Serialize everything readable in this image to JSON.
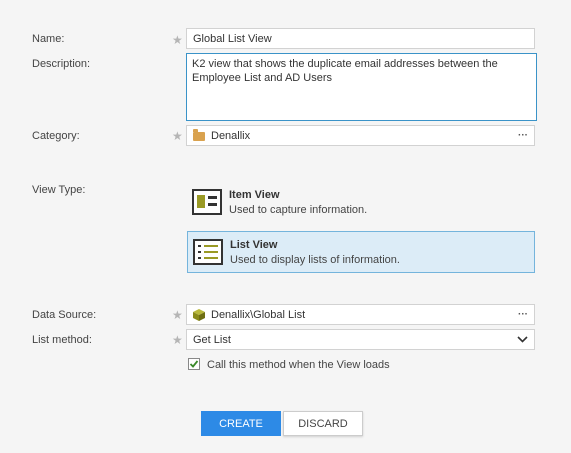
{
  "form": {
    "name": {
      "label": "Name:",
      "value": "Global List View"
    },
    "description": {
      "label": "Description:",
      "value": "K2 view that shows the duplicate email addresses between the Employee List and AD Users"
    },
    "category": {
      "label": "Category:",
      "value": "Denallix",
      "icon": "folder-icon"
    },
    "view_type": {
      "label": "View Type:",
      "options": [
        {
          "title": "Item View",
          "desc": "Used to capture information.",
          "selected": false
        },
        {
          "title": "List View",
          "desc": "Used to display lists of information.",
          "selected": true
        }
      ]
    },
    "data_source": {
      "label": "Data Source:",
      "value": "Denallix\\Global List",
      "icon": "cube-icon"
    },
    "list_method": {
      "label": "List method:",
      "value": "Get List"
    },
    "load_checkbox": {
      "label": "Call this method when the View loads",
      "checked": true
    },
    "ellipsis": "···"
  },
  "buttons": {
    "create": "CREATE",
    "discard": "DISCARD"
  },
  "colors": {
    "accent": "#2d8ae6",
    "selected_bg": "#dcecf7",
    "folder": "#d9a24f",
    "cube": "#8a8a1a"
  }
}
